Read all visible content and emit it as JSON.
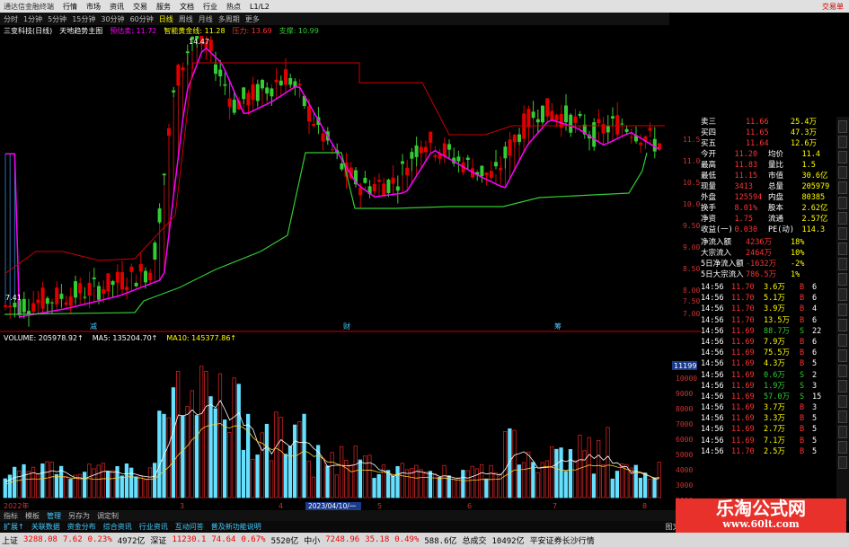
{
  "menubar": {
    "app_title": "通达信金融终端",
    "items": [
      "行情",
      "市场",
      "资讯",
      "交易",
      "服务",
      "文档",
      "行业",
      "热点",
      "L1/L2"
    ],
    "right_label": "交易单"
  },
  "periodbar": {
    "periods": [
      "分时",
      "1分钟",
      "5分钟",
      "15分钟",
      "30分钟",
      "60分钟",
      "日线",
      "周线",
      "月线",
      "多周期",
      "更多"
    ],
    "active": "日线"
  },
  "infobar": {
    "stock_name": "三变科技(日线)",
    "indicator": "天地趋势主图",
    "item1": "预估卖: 11.72",
    "item2": "智能黄金线: 11.28",
    "item3": "压力: 13.69",
    "item4": "支撑: 10.99"
  },
  "main_labels": {
    "high_price": "14.47",
    "low_price": "7.41",
    "y_ticks": [
      "11.50",
      "11.00",
      "10.50",
      "10.00",
      "9.50",
      "9.00",
      "8.50",
      "8.00",
      "7.50",
      "7.00"
    ],
    "x_marks": [
      "减",
      "财",
      "筹"
    ]
  },
  "volume_bar": {
    "volume": "VOLUME: 205978.92↑",
    "ma5": "MA5: 135204.70↑",
    "ma10": "MA10: 145377.86↑",
    "y_ticks": [
      "10000",
      "9000",
      "8000",
      "7000",
      "6000",
      "5000",
      "4000",
      "3000",
      "2000",
      "1000"
    ],
    "y_unit_top": "11199",
    "date_marker": "2023/04/10/一",
    "x_labels": [
      "2022年",
      "3",
      "4",
      "5",
      "6",
      "7",
      "8"
    ]
  },
  "quote_panel": {
    "rows": [
      {
        "label": "卖三",
        "price": "11.66",
        "vol": "25.4万"
      },
      {
        "label": "买四",
        "price": "11.65",
        "vol": "47.3万"
      },
      {
        "label": "买五",
        "price": "11.64",
        "vol": "12.6万"
      },
      {
        "label": "今开",
        "price": "11.20",
        "k2": "均价",
        "v2": "11.4"
      },
      {
        "label": "最高",
        "price": "11.83",
        "k2": "量比",
        "v2": "1.5"
      },
      {
        "label": "最低",
        "price": "11.15",
        "k2": "市值",
        "v2": "30.6亿"
      },
      {
        "label": "现量",
        "price": "3413",
        "k2": "总量",
        "v2": "205979"
      },
      {
        "label": "外盘",
        "price": "125594",
        "k2": "内盘",
        "v2": "80385"
      },
      {
        "label": "换手",
        "price": "8.01%",
        "k2": "股本",
        "v2": "2.62亿"
      },
      {
        "label": "净资",
        "price": "1.75",
        "k2": "流通",
        "v2": "2.57亿"
      },
      {
        "label": "收益(一)",
        "price": "0.030",
        "k2": "PE(动)",
        "v2": "114.3"
      }
    ],
    "flows": [
      {
        "label": "净流入额",
        "value": "4236万",
        "pct": "18%"
      },
      {
        "label": "大宗流入",
        "value": "2464万",
        "pct": "10%"
      },
      {
        "label": "5日净流入额",
        "value": "-1632万",
        "pct": "-2%"
      },
      {
        "label": "5日大宗流入",
        "value": "786.5万",
        "pct": "1%"
      }
    ],
    "ticks": [
      {
        "t": "14:56",
        "p": "11.70",
        "v": "3.6万",
        "s": "B",
        "n": "6"
      },
      {
        "t": "14:56",
        "p": "11.70",
        "v": "5.1万",
        "s": "B",
        "n": "6"
      },
      {
        "t": "14:56",
        "p": "11.70",
        "v": "3.9万",
        "s": "B",
        "n": "4"
      },
      {
        "t": "14:56",
        "p": "11.70",
        "v": "13.5万",
        "s": "B",
        "n": "6"
      },
      {
        "t": "14:56",
        "p": "11.69",
        "v": "88.7万",
        "s": "S",
        "n": "22"
      },
      {
        "t": "14:56",
        "p": "11.69",
        "v": "7.9万",
        "s": "B",
        "n": "6"
      },
      {
        "t": "14:56",
        "p": "11.69",
        "v": "75.5万",
        "s": "B",
        "n": "6"
      },
      {
        "t": "14:56",
        "p": "11.69",
        "v": "4.3万",
        "s": "B",
        "n": "5"
      },
      {
        "t": "14:56",
        "p": "11.69",
        "v": "0.6万",
        "s": "S",
        "n": "2"
      },
      {
        "t": "14:56",
        "p": "11.69",
        "v": "1.9万",
        "s": "S",
        "n": "3"
      },
      {
        "t": "14:56",
        "p": "11.69",
        "v": "57.0万",
        "s": "S",
        "n": "15"
      },
      {
        "t": "14:56",
        "p": "11.69",
        "v": "3.7万",
        "s": "B",
        "n": "3"
      },
      {
        "t": "14:56",
        "p": "11.69",
        "v": "3.3万",
        "s": "B",
        "n": "5"
      },
      {
        "t": "14:56",
        "p": "11.69",
        "v": "2.7万",
        "s": "B",
        "n": "5"
      },
      {
        "t": "14:56",
        "p": "11.69",
        "v": "7.1万",
        "s": "B",
        "n": "5"
      },
      {
        "t": "14:56",
        "p": "11.70",
        "v": "2.5万",
        "s": "B",
        "n": "5"
      }
    ]
  },
  "bottom_tabs": {
    "row1": [
      "指标",
      "模板",
      "管理",
      "另存为",
      "调定制"
    ],
    "row2": [
      "扩展↑",
      "关联数据",
      "资金分布",
      "综合资讯",
      "行业资讯",
      "互动问答",
      "普及新功能说明"
    ],
    "row2_right": "图文F10 ◆"
  },
  "statusbar": {
    "sh_label": "上证",
    "sh_val": "3288.08",
    "sh_chg": "7.62",
    "sh_pct": "0.23%",
    "sh_amt": "4972亿",
    "sz_label": "深证",
    "sz_val": "11230.1",
    "sz_chg": "74.64",
    "sz_pct": "0.67%",
    "sz_amt": "5520亿",
    "zx_label": "中小",
    "zx_val": "7248.96",
    "zx_chg": "35.18",
    "zx_pct": "0.49%",
    "zx_amt": "588.6亿",
    "total_label": "总成交",
    "total_val": "10492亿",
    "broker": "平安证券长沙行情"
  },
  "watermark": {
    "title": "乐淘公式网",
    "url": "www.60lt.com"
  },
  "colors": {
    "up": "#e00000",
    "down": "#33cc33",
    "ma": "#ff00ff",
    "support": "#33cc33",
    "resist": "#cc0000",
    "vol": "#66e0ff"
  }
}
